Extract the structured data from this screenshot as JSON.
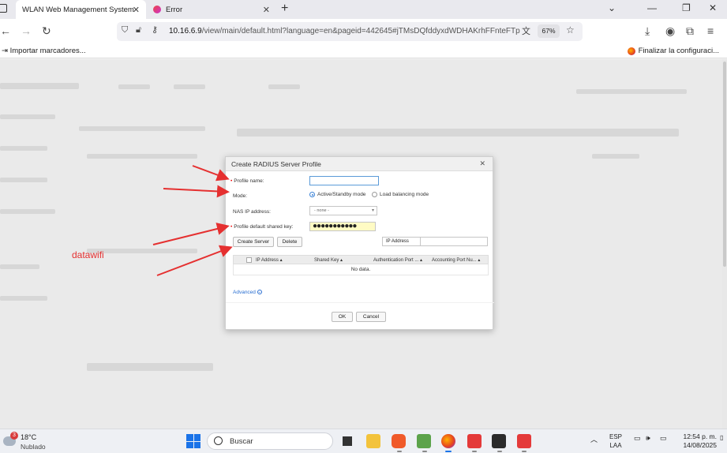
{
  "browser": {
    "tabs": [
      {
        "label": "WLAN Web Management System",
        "active": true
      },
      {
        "label": "Error",
        "active": false
      }
    ],
    "url_host": "10.16.6.9",
    "url_rest": "/view/main/default.html?language=en&pageid=442645#jTMsDQfddyxdWDHAKrhFFnteFTp",
    "zoom": "67%",
    "bookmarks_left": "Importar marcadores...",
    "bookmarks_right": "Finalizar la configuraci..."
  },
  "dialog": {
    "title": "Create RADIUS Server Profile",
    "labels": {
      "profile_name": "Profile name:",
      "mode": "Mode:",
      "nas_ip": "NAS IP address:",
      "shared_key": "Profile default shared key:"
    },
    "profile_name_value": "",
    "mode_options": [
      "Active/Standby mode",
      "Load balancing mode"
    ],
    "mode_selected": "Active/Standby mode",
    "nas_ip_value": "- none -",
    "shared_key_value": "●●●●●●●●●●●",
    "buttons": {
      "create_server": "Create Server",
      "delete": "Delete",
      "ok": "OK",
      "cancel": "Cancel"
    },
    "filter_label": "IP Address",
    "filter_value": "",
    "table_columns": [
      "IP Address",
      "Shared Key",
      "Authentication Port ...",
      "Accounting Port Nu..."
    ],
    "empty_text": "No data.",
    "advanced": "Advanced"
  },
  "annotation": {
    "text": "datawifi",
    "color": "#e53030"
  },
  "taskbar": {
    "weather_badge": "3",
    "weather_temp": "18°C",
    "weather_desc": "Nublado",
    "search_placeholder": "Buscar",
    "lang_top": "ESP",
    "lang_bottom": "LAA",
    "time": "12:54 p. m.",
    "date": "14/08/2025"
  }
}
